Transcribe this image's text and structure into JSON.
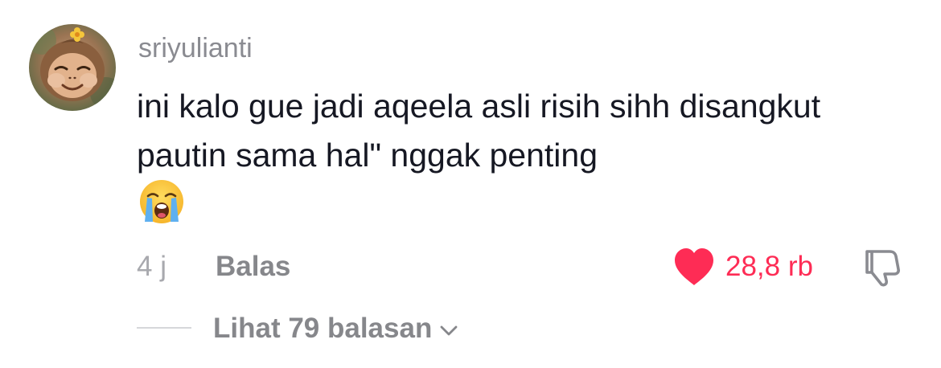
{
  "comment": {
    "username": "sriyulianti",
    "text": "ini kalo gue jadi aqeela asli risih sihh disangkut pautin sama hal\" nggak penting",
    "emoji": "loudly-crying-face-emoji",
    "time_ago": "4 j",
    "reply_label": "Balas",
    "like_count": "28,8 rb",
    "liked": true,
    "view_replies_label": "Lihat 79 balasan"
  },
  "colors": {
    "like_red": "#fe2c55",
    "meta_gray": "#86878b",
    "username_gray": "#8a8b91"
  },
  "icons": {
    "like": "heart-icon",
    "dislike": "thumbs-down-icon",
    "expand": "chevron-down-icon"
  }
}
